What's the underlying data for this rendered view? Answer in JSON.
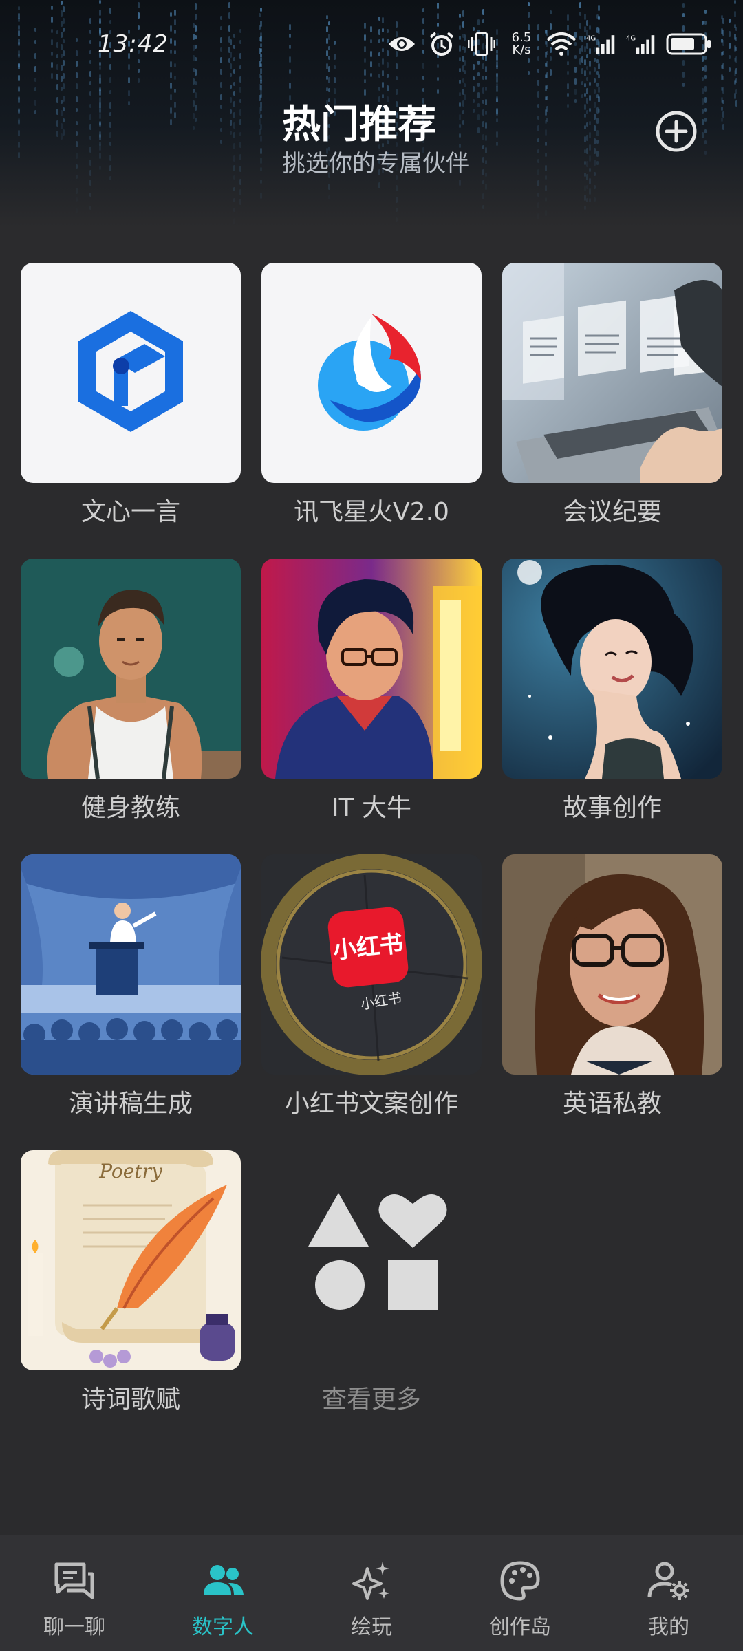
{
  "status_bar": {
    "time": "13:42",
    "net_speed_value": "6.5",
    "net_speed_unit": "K/s",
    "icons": [
      "eye-icon",
      "alarm-icon",
      "vibrate-icon",
      "speed-text",
      "wifi-icon",
      "signal-4g-icon",
      "signal-4g-icon",
      "battery-icon"
    ]
  },
  "header": {
    "title": "热门推荐",
    "subtitle": "挑选你的专属伙伴"
  },
  "cards": [
    {
      "label": "文心一言",
      "icon": "wenxin-logo"
    },
    {
      "label": "讯飞星火V2.0",
      "icon": "xunfei-logo"
    },
    {
      "label": "会议纪要",
      "icon": "meeting-image"
    },
    {
      "label": "健身教练",
      "icon": "fitness-coach-image"
    },
    {
      "label": "IT 大牛",
      "icon": "it-expert-image"
    },
    {
      "label": "故事创作",
      "icon": "story-image"
    },
    {
      "label": "演讲稿生成",
      "icon": "speech-image"
    },
    {
      "label": "小红书文案创作",
      "icon": "xiaohongshu-image"
    },
    {
      "label": "英语私教",
      "icon": "english-tutor-image"
    },
    {
      "label": "诗词歌赋",
      "icon": "poetry-image"
    }
  ],
  "xiaohongshu_logo_text": "小红书",
  "poetry_script_text": "Poetry",
  "more": {
    "label": "查看更多"
  },
  "bottom_nav": [
    {
      "label": "聊一聊",
      "icon": "chat-icon"
    },
    {
      "label": "数字人",
      "icon": "people-icon",
      "active": true
    },
    {
      "label": "绘玩",
      "icon": "sparkle-icon"
    },
    {
      "label": "创作岛",
      "icon": "palette-icon"
    },
    {
      "label": "我的",
      "icon": "user-settings-icon"
    }
  ],
  "colors": {
    "background": "#2b2b2d",
    "accent": "#2ac3c8",
    "nav_background": "#323235"
  }
}
